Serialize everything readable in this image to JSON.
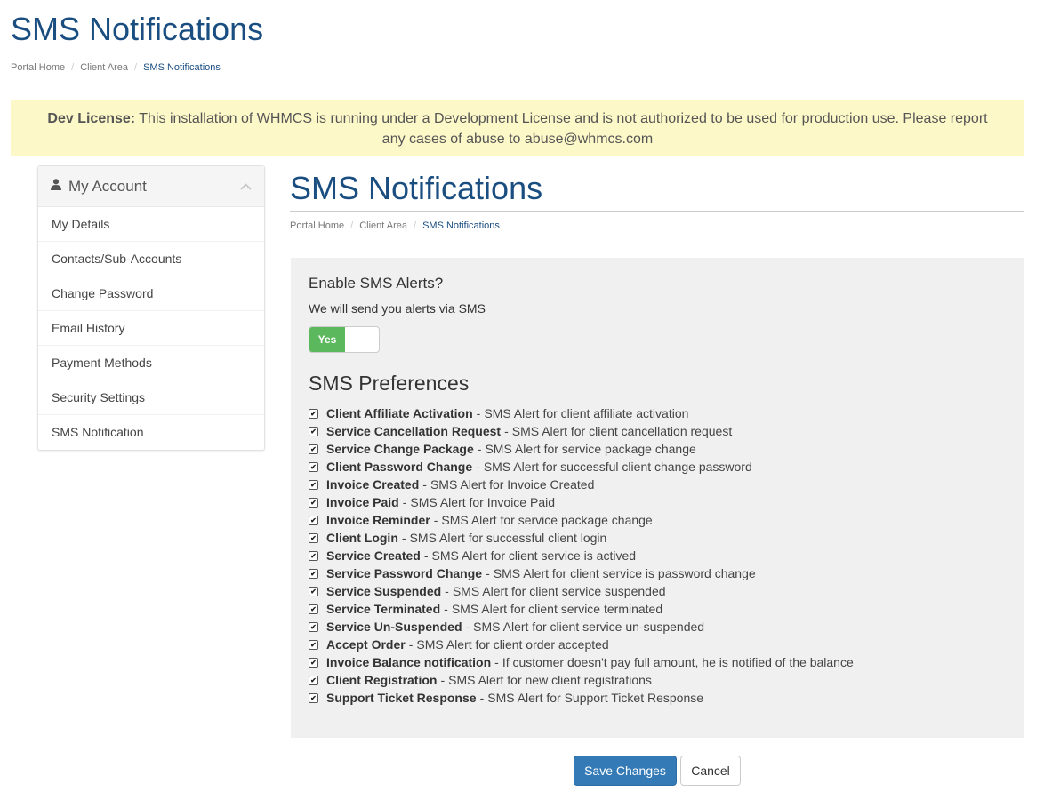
{
  "header": {
    "title": "SMS Notifications",
    "breadcrumb": [
      "Portal Home",
      "Client Area",
      "SMS Notifications"
    ]
  },
  "dev_alert": {
    "label": "Dev License:",
    "text": "This installation of WHMCS is running under a Development License and is not authorized to be used for production use. Please report any cases of abuse to abuse@whmcs.com"
  },
  "sidebar": {
    "title": "My Account",
    "icon": "user-icon",
    "items": [
      {
        "label": "My Details"
      },
      {
        "label": "Contacts/Sub-Accounts"
      },
      {
        "label": "Change Password"
      },
      {
        "label": "Email History"
      },
      {
        "label": "Payment Methods"
      },
      {
        "label": "Security Settings"
      },
      {
        "label": "SMS Notification"
      }
    ]
  },
  "main": {
    "title": "SMS Notifications",
    "breadcrumb": [
      "Portal Home",
      "Client Area",
      "SMS Notifications"
    ],
    "enable": {
      "title": "Enable SMS Alerts?",
      "subtitle": "We will send you alerts via SMS",
      "toggle_label": "Yes",
      "toggle_on": true
    },
    "preferences_title": "SMS Preferences",
    "preferences": [
      {
        "name": "Client Affiliate Activation",
        "desc": "SMS Alert for client affiliate activation",
        "checked": true
      },
      {
        "name": "Service Cancellation Request",
        "desc": "SMS Alert for client cancellation request",
        "checked": true
      },
      {
        "name": "Service Change Package",
        "desc": "SMS Alert for service package change",
        "checked": true
      },
      {
        "name": "Client Password Change",
        "desc": "SMS Alert for successful client change password",
        "checked": true
      },
      {
        "name": "Invoice Created",
        "desc": "SMS Alert for Invoice Created",
        "checked": true
      },
      {
        "name": "Invoice Paid",
        "desc": "SMS Alert for Invoice Paid",
        "checked": true
      },
      {
        "name": "Invoice Reminder",
        "desc": "SMS Alert for service package change",
        "checked": true
      },
      {
        "name": "Client Login",
        "desc": "SMS Alert for successful client login",
        "checked": true
      },
      {
        "name": "Service Created",
        "desc": "SMS Alert for client service is actived",
        "checked": true
      },
      {
        "name": "Service Password Change",
        "desc": "SMS Alert for client service is password change",
        "checked": true
      },
      {
        "name": "Service Suspended",
        "desc": "SMS Alert for client service suspended",
        "checked": true
      },
      {
        "name": "Service Terminated",
        "desc": "SMS Alert for client service terminated",
        "checked": true
      },
      {
        "name": "Service Un-Suspended",
        "desc": "SMS Alert for client service un-suspended",
        "checked": true
      },
      {
        "name": "Accept Order",
        "desc": "SMS Alert for client order accepted",
        "checked": true
      },
      {
        "name": "Invoice Balance notification",
        "desc": "If customer doesn't pay full amount, he is notified of the balance",
        "checked": true
      },
      {
        "name": "Client Registration",
        "desc": "SMS Alert for new client registrations",
        "checked": true
      },
      {
        "name": "Support Ticket Response",
        "desc": "SMS Alert for Support Ticket Response",
        "checked": true
      }
    ],
    "save_label": "Save Changes",
    "cancel_label": "Cancel"
  },
  "colors": {
    "brand": "#1a4d80",
    "alert_bg": "#fcf8c8",
    "toggle_on": "#5cb85c",
    "primary_button": "#337ab7",
    "panel_bg": "#f0f0f0"
  }
}
